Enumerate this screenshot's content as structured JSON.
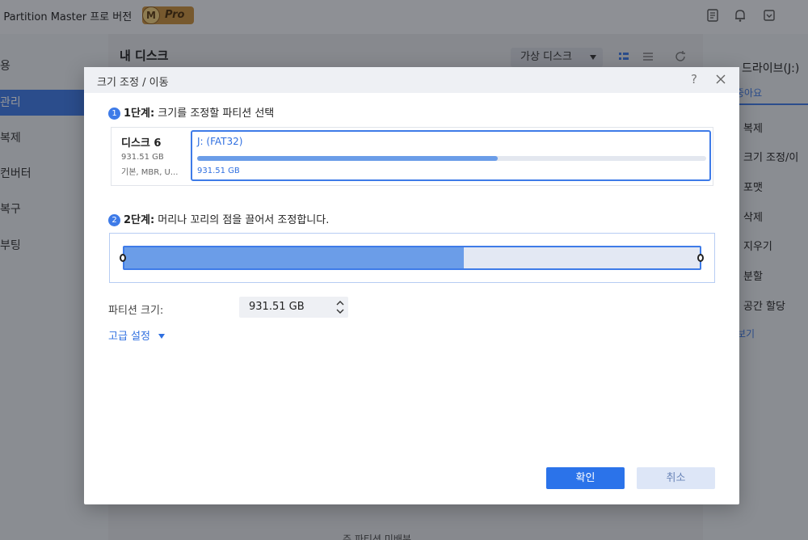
{
  "app": {
    "title": "S Partition Master 프로 버전",
    "badge_letter": "M",
    "badge_text": "Pro"
  },
  "sidebar": {
    "items": [
      {
        "label": "용"
      },
      {
        "label": "관리"
      },
      {
        "label": "복제"
      },
      {
        "label": "컨버터"
      },
      {
        "label": "복구"
      },
      {
        "label": "부팅"
      }
    ],
    "active_index": 1
  },
  "main": {
    "title": "내 디스크",
    "virtual_disk_label": "가상 디스크",
    "legend": "주 파티션   미배분"
  },
  "right_panel": {
    "title": "드라이브(J:)",
    "tab_label": "중아요",
    "items": [
      "복제",
      "크기 조정/이",
      "포맷",
      "삭제",
      "지우기",
      "분할",
      "공간 할당"
    ],
    "more_label": "보기"
  },
  "dialog": {
    "title": "크기 조정 / 이동",
    "help_label": "?",
    "step1": {
      "num": "1",
      "bold": "1단계:",
      "text": " 크기를 조정할 파티션 선택"
    },
    "disk": {
      "name": "디스크 6",
      "size": "931.51 GB",
      "type": "기본, MBR, U..."
    },
    "partition": {
      "label": "J: (FAT32)",
      "size": "931.51 GB",
      "used_fraction": 0.59
    },
    "step2": {
      "num": "2",
      "bold": "2단계:",
      "text": " 머리나 꼬리의 점을 끌어서 조정합니다."
    },
    "resize": {
      "used_fraction": 0.59
    },
    "size_field": {
      "label": "파티션 크기:",
      "value": "931.51 GB"
    },
    "advanced_label": "고급 설정",
    "ok_label": "확인",
    "cancel_label": "취소"
  },
  "colors": {
    "accent": "#2b73ea",
    "fill": "#6b9de8",
    "cancel_bg": "#dde6f7"
  }
}
